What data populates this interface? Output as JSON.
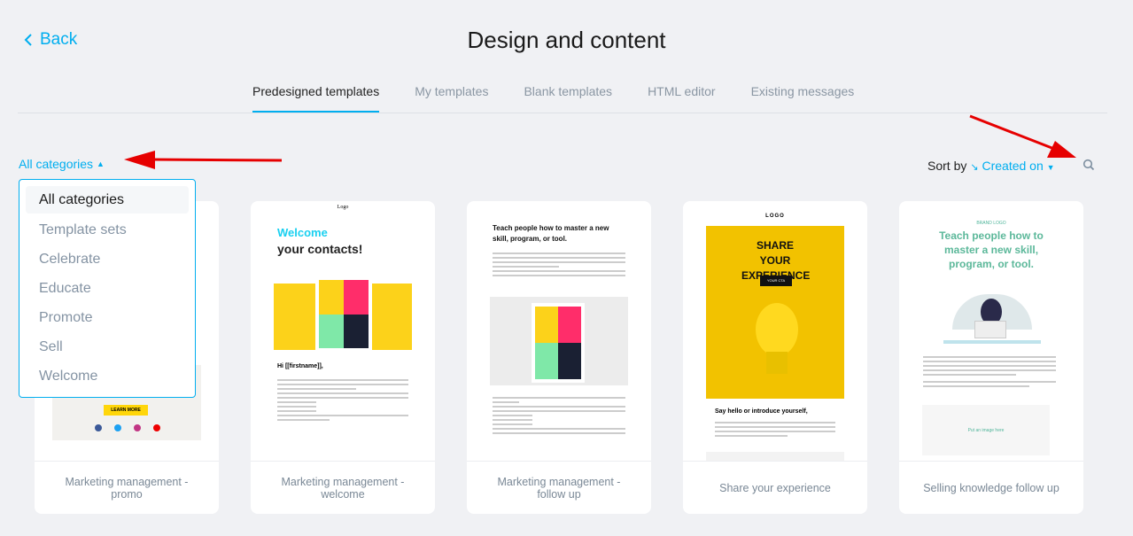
{
  "header": {
    "back_label": "Back",
    "title": "Design and content"
  },
  "tabs": [
    {
      "label": "Predesigned templates",
      "active": true
    },
    {
      "label": "My templates"
    },
    {
      "label": "Blank templates"
    },
    {
      "label": "HTML editor"
    },
    {
      "label": "Existing messages"
    }
  ],
  "filter": {
    "selected": "All categories",
    "options": [
      "All categories",
      "Template sets",
      "Celebrate",
      "Educate",
      "Promote",
      "Sell",
      "Welcome"
    ]
  },
  "sort": {
    "label": "Sort by",
    "value": "Created on"
  },
  "accent": "#00aeef",
  "cards": [
    {
      "name": "Marketing management - promo",
      "thumb": {
        "cta": "LEARN MORE"
      }
    },
    {
      "name": "Marketing management - welcome",
      "thumb": {
        "logo": "Logo",
        "headline1": "Welcome",
        "headline2": "your contacts!",
        "greeting": "Hi [[firstname]],"
      }
    },
    {
      "name": "Marketing management - follow up",
      "thumb": {
        "headline": "Teach people how to master a new skill, program, or tool."
      }
    },
    {
      "name": "Share your experience",
      "thumb": {
        "logo": "LOGO",
        "headline": "SHARE YOUR EXPERIENCE",
        "cta": "YOUR CTA",
        "subhead": "Say hello or introduce yourself,"
      }
    },
    {
      "name": "Selling knowledge follow up",
      "thumb": {
        "logo": "BRAND LOGO",
        "headline": "Teach people how to master a new skill, program, or tool.",
        "placeholder": "Put an image here"
      }
    }
  ]
}
